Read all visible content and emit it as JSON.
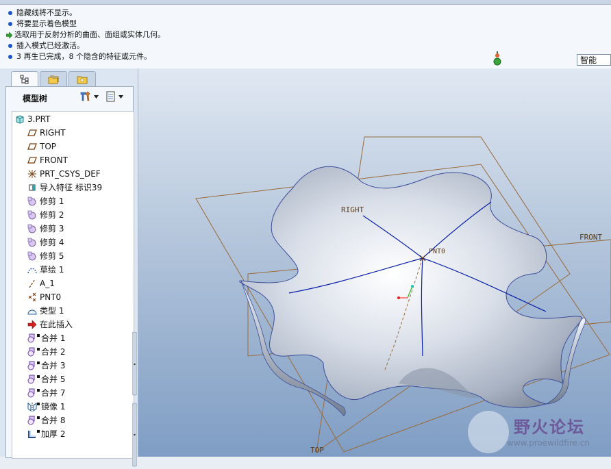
{
  "messages": [
    {
      "type": "bullet",
      "text": "隐藏线将不显示。"
    },
    {
      "type": "bullet",
      "text": "将要显示着色模型"
    },
    {
      "type": "arrow",
      "text": "选取用于反射分析的曲面、面组或实体几何。"
    },
    {
      "type": "bullet",
      "text": "插入模式已经激活。"
    },
    {
      "type": "bullet",
      "text": "3 再生已完成，8 个隐含的特征或元件。"
    }
  ],
  "filter": {
    "value": "智能"
  },
  "tree": {
    "title": "模型树",
    "items": [
      {
        "label": "3.PRT",
        "icon": "part-icon"
      },
      {
        "label": "RIGHT",
        "icon": "datum-plane-icon"
      },
      {
        "label": "TOP",
        "icon": "datum-plane-icon"
      },
      {
        "label": "FRONT",
        "icon": "datum-plane-icon"
      },
      {
        "label": "PRT_CSYS_DEF",
        "icon": "coordinate-system-icon"
      },
      {
        "label": "导入特征 标识39",
        "icon": "import-feature-icon"
      },
      {
        "label": "修剪 1",
        "icon": "trim-icon"
      },
      {
        "label": "修剪 2",
        "icon": "trim-icon"
      },
      {
        "label": "修剪 3",
        "icon": "trim-icon"
      },
      {
        "label": "修剪 4",
        "icon": "trim-icon"
      },
      {
        "label": "修剪 5",
        "icon": "trim-icon"
      },
      {
        "label": "草绘 1",
        "icon": "sketch-icon"
      },
      {
        "label": "A_1",
        "icon": "datum-axis-icon"
      },
      {
        "label": "PNT0",
        "icon": "datum-point-icon"
      },
      {
        "label": "类型 1",
        "icon": "style-icon"
      },
      {
        "label": "在此插入",
        "icon": "insert-here-icon"
      },
      {
        "label": "合并 1",
        "icon": "merge-icon"
      },
      {
        "label": "合并 2",
        "icon": "merge-icon"
      },
      {
        "label": "合并 3",
        "icon": "merge-icon"
      },
      {
        "label": "合并 5",
        "icon": "merge-icon"
      },
      {
        "label": "合并 7",
        "icon": "merge-icon"
      },
      {
        "label": "镜像 1",
        "icon": "mirror-icon"
      },
      {
        "label": "合并 8",
        "icon": "merge-icon"
      },
      {
        "label": "加厚 2",
        "icon": "thicken-icon"
      }
    ]
  },
  "viewport": {
    "labels": {
      "right": "RIGHT",
      "front": "FRONT",
      "top": "TOP",
      "point": "PNT0"
    }
  },
  "watermark": {
    "title": "野火论坛",
    "url": "www.proewildfire.cn"
  }
}
